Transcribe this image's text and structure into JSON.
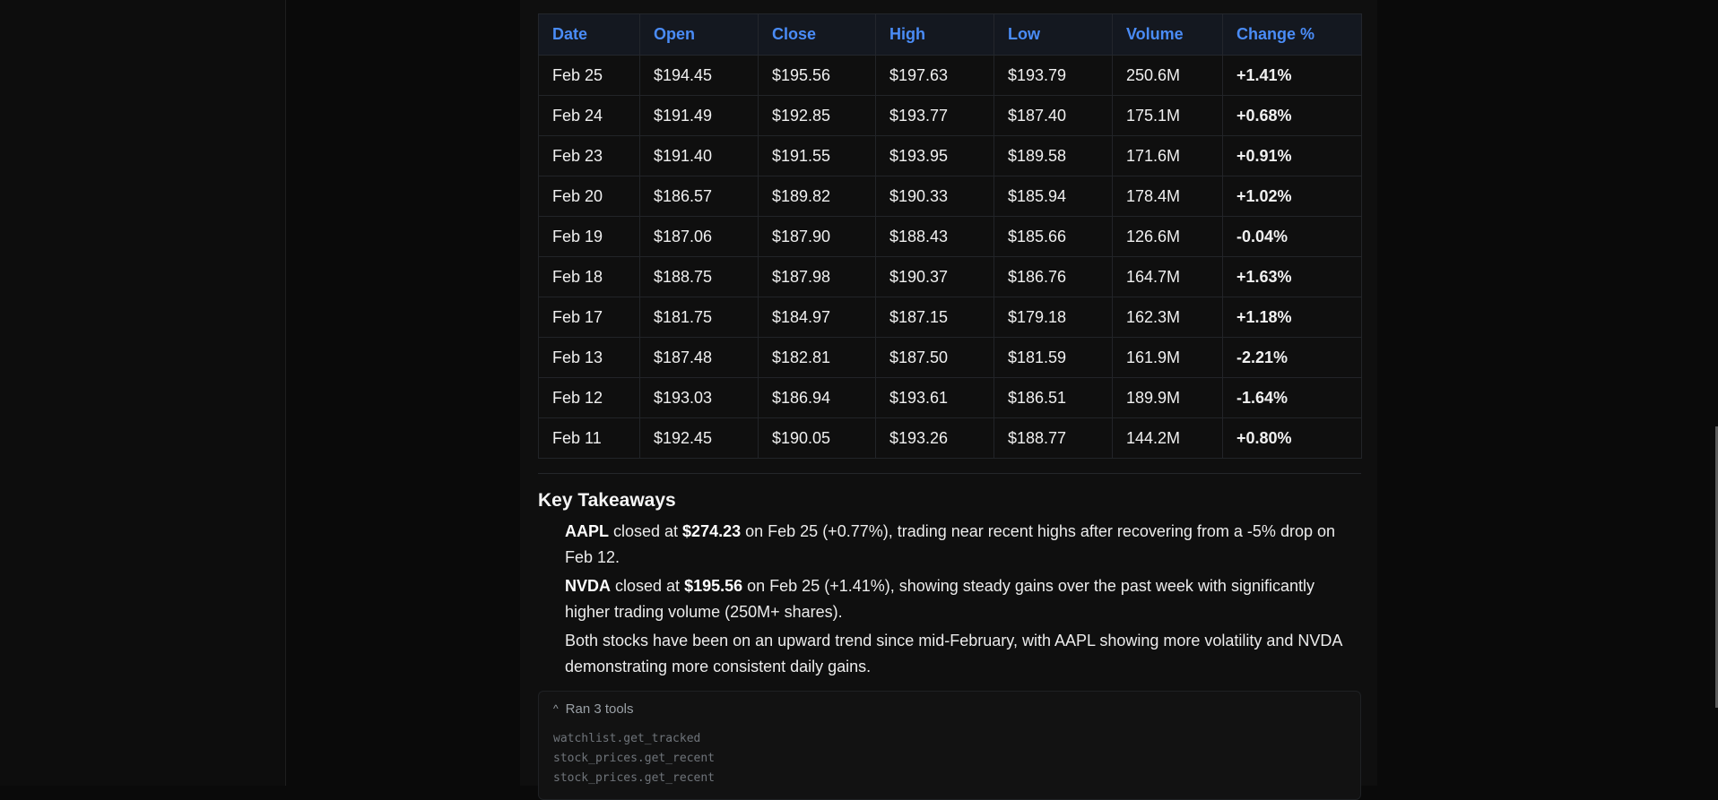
{
  "table": {
    "headers": [
      "Date",
      "Open",
      "Close",
      "High",
      "Low",
      "Volume",
      "Change %"
    ],
    "rows": [
      [
        "Feb 25",
        "$194.45",
        "$195.56",
        "$197.63",
        "$193.79",
        "250.6M",
        "+1.41%"
      ],
      [
        "Feb 24",
        "$191.49",
        "$192.85",
        "$193.77",
        "$187.40",
        "175.1M",
        "+0.68%"
      ],
      [
        "Feb 23",
        "$191.40",
        "$191.55",
        "$193.95",
        "$189.58",
        "171.6M",
        "+0.91%"
      ],
      [
        "Feb 20",
        "$186.57",
        "$189.82",
        "$190.33",
        "$185.94",
        "178.4M",
        "+1.02%"
      ],
      [
        "Feb 19",
        "$187.06",
        "$187.90",
        "$188.43",
        "$185.66",
        "126.6M",
        "-0.04%"
      ],
      [
        "Feb 18",
        "$188.75",
        "$187.98",
        "$190.37",
        "$186.76",
        "164.7M",
        "+1.63%"
      ],
      [
        "Feb 17",
        "$181.75",
        "$184.97",
        "$187.15",
        "$179.18",
        "162.3M",
        "+1.18%"
      ],
      [
        "Feb 13",
        "$187.48",
        "$182.81",
        "$187.50",
        "$181.59",
        "161.9M",
        "-2.21%"
      ],
      [
        "Feb 12",
        "$193.03",
        "$186.94",
        "$193.61",
        "$186.51",
        "189.9M",
        "-1.64%"
      ],
      [
        "Feb 11",
        "$192.45",
        "$190.05",
        "$193.26",
        "$188.77",
        "144.2M",
        "+0.80%"
      ]
    ]
  },
  "takeaways": {
    "heading": "Key Takeaways",
    "b1": {
      "ticker": "AAPL",
      "t1": " closed at ",
      "price": "$274.23",
      "t2": " on Feb 25 (+0.77%), trading near recent highs after recovering from a -5% drop on Feb 12."
    },
    "b2": {
      "ticker": "NVDA",
      "t1": " closed at ",
      "price": "$195.56",
      "t2": " on Feb 25 (+1.41%), showing steady gains over the past week with significantly higher trading volume (250M+ shares)."
    },
    "b3": "Both stocks have been on an upward trend since mid-February, with AAPL showing more volatility and NVDA demonstrating more consistent daily gains."
  },
  "tools": {
    "summary": "Ran 3 tools",
    "calls": [
      "watchlist.get_tracked",
      "stock_prices.get_recent",
      "stock_prices.get_recent"
    ]
  },
  "colors": {
    "header_text": "#4a8cf7",
    "positive": "#2fd472",
    "negative": "#f2435a",
    "background": "#0f0f0f"
  },
  "icons": {
    "tools_toggle": "chevron-up-icon"
  }
}
